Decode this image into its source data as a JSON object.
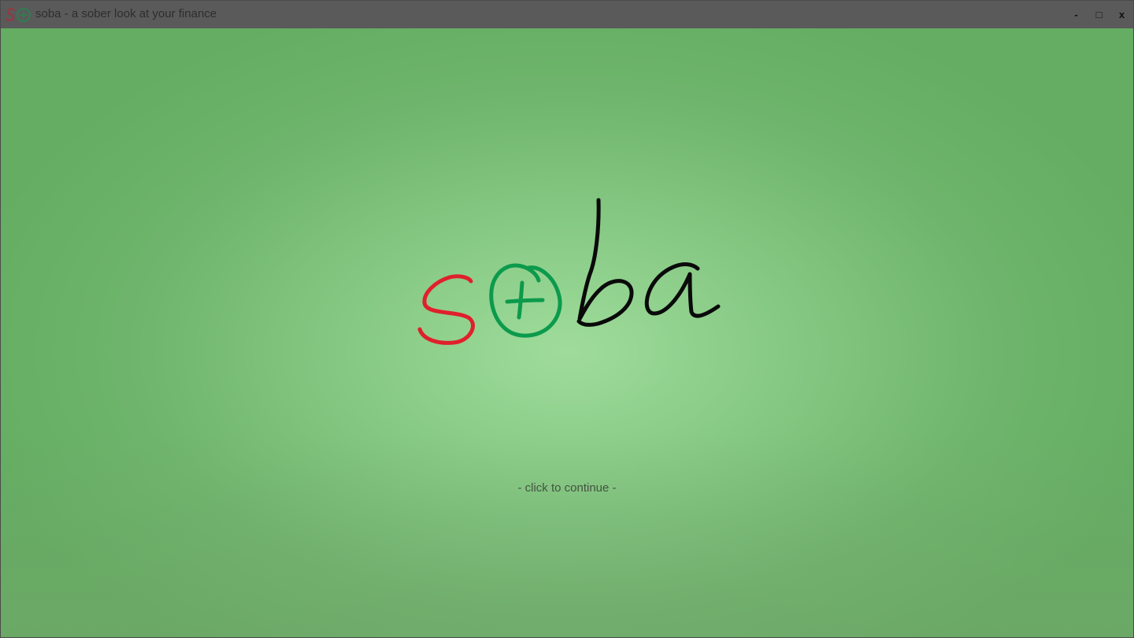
{
  "window": {
    "title": "soba - a sober look at your finance",
    "controls": {
      "minimize": "-",
      "maximize": "□",
      "close": "x"
    }
  },
  "splash": {
    "logo_text": "soba",
    "logo_icon": "soba-logo-icon",
    "continue_text": "- click to continue -"
  },
  "colors": {
    "logo_s": "#e0202c",
    "logo_o": "#0c9a4c",
    "logo_ba": "#0a0a0a",
    "background_center": "#9fdc9b",
    "background_edge": "#64ad62",
    "titlebar": "#5a5a5a"
  }
}
